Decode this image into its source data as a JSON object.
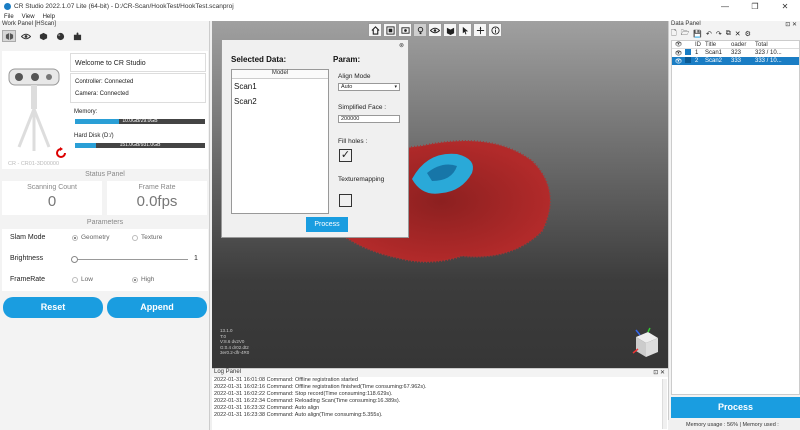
{
  "window": {
    "title": "CR Studio 2022.1.07 Lite (64-bit) - D:/CR-Scan/HookTest/HookTest.scanproj",
    "min": "—",
    "max": "❐",
    "close": "✕"
  },
  "menu": [
    "File",
    "View",
    "Help"
  ],
  "work_panel": {
    "header": "Work Panel [HScan]",
    "tool_icons": [
      "scan-mode-icon",
      "eye-icon",
      "cube-icon",
      "sphere-icon",
      "puzzle-icon"
    ],
    "device_name": "CR - CR01-3D00000",
    "welcome": "Welcome to CR Studio",
    "controller": "Controller: Connected",
    "camera": "Camera: Connected",
    "memory_label": "Memory:",
    "memory_text": "10.0GB/29.0GB",
    "memory_fraction": 0.34,
    "disk_label": "Hard Disk (D:/)",
    "disk_text": "151.0GB/931.0GB",
    "disk_fraction": 0.16
  },
  "status_panel": {
    "title": "Status Panel",
    "scanning_count_label": "Scanning Count",
    "scanning_count": "0",
    "frame_rate_label": "Frame Rate",
    "frame_rate": "0.0fps"
  },
  "parameters": {
    "title": "Parameters",
    "slam_mode_label": "Slam Mode",
    "slam_options": [
      "Geometry",
      "Texture"
    ],
    "slam_selected": "Geometry",
    "brightness_label": "Brightness",
    "brightness_value": "1",
    "framerate_label": "FrameRate",
    "framerate_options": [
      "Low",
      "High"
    ],
    "framerate_selected": "High"
  },
  "buttons": {
    "reset": "Reset",
    "append": "Append"
  },
  "viewport": {
    "toolbar_icons": [
      "home-icon",
      "fit-view-icon",
      "screenshot-icon",
      "light-icon",
      "visibility-icon",
      "texture-icon",
      "select-icon",
      "axis-icon",
      "info-icon"
    ],
    "readout": [
      "13.1.0",
      "T:0",
      "V:8.6 dv2V0",
      "G:0.4 dr02.dt2",
      "3er0.2-dfr-4R0"
    ]
  },
  "dialog": {
    "close": "⊗",
    "selected_data_title": "Selected Data:",
    "model_header": "Model",
    "models": [
      "Scan1",
      "Scan2"
    ],
    "param_title": "Param:",
    "align_mode_label": "Align Mode",
    "align_mode_value": "Auto",
    "simplified_face_label": "Simplified Face :",
    "simplified_face_value": "200000",
    "fill_holes_label": "Fill holes :",
    "fill_holes_checked": "✓",
    "texture_label": "Texturemapping",
    "texture_checked": "",
    "process": "Process"
  },
  "log_panel": {
    "title": "Log Panel",
    "controls": "⊡ ✕",
    "lines": [
      "2022-01-31 16:01:08 Command: Offline registration started",
      "2022-01-31 16:02:16 Command: Offline registration finished(Time consuming:67.962s).",
      "2022-01-31 16:02:22 Command: Stop record(Time consuming:118.629s).",
      "2022-01-31 16:22:34 Command: Reloading Scan(Time consuming:16.389s).",
      "2022-01-31 16:23:32 Command: Auto align",
      "2022-01-31 16:23:38 Command: Auto align(Time consuming:5.355s)."
    ]
  },
  "data_panel": {
    "title": "Data Panel",
    "controls": "⊡ ✕",
    "tool_glyphs": [
      "🗋",
      "🗁",
      "💾",
      "↶",
      "↷",
      "⧉",
      "✕",
      "⚙"
    ],
    "columns": [
      "",
      "",
      "ID",
      "Title",
      "oader",
      "Total"
    ],
    "rows": [
      {
        "id": "1",
        "title": "Scan1",
        "loaded": "323",
        "total": "323 / 10..."
      },
      {
        "id": "2",
        "title": "Scan2",
        "loaded": "333",
        "total": "333 / 10..."
      }
    ],
    "process": "Process"
  },
  "status_bar": {
    "text": "Memory usage : 56% | Memory used : 4623MB"
  }
}
